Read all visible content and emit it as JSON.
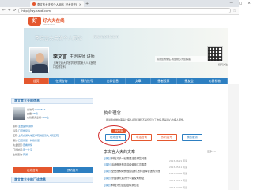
{
  "browser": {
    "tab_title": "李文言大夫的个人网站_好大夫在线",
    "tab_close": "×",
    "new_tab": "+",
    "window_controls": [
      "—",
      "□",
      "×"
    ],
    "nav_buttons": [
      "←",
      "→",
      "⟳"
    ],
    "url": "http://lwy.haodf.com/",
    "star": "☆"
  },
  "site": {
    "logo_text": "好",
    "brand": "好大夫在线",
    "brand_sub": "haodf.com",
    "banner_title": "李文言大夫的个人网站",
    "banner_domain": "lwy.haodf.com",
    "banner_tagline": "感谢您的信任,我会耐心为您解答"
  },
  "doctor": {
    "name": "李文言",
    "title": "主治医师 讲师",
    "hospital": "上海交通大学医学院附属第九人民医院",
    "department": "口腔修复科",
    "qr_label": "扫码关注"
  },
  "nav": {
    "items": [
      "首页",
      "在线咨询",
      "预约挂号",
      "出诊信息",
      "文章",
      "患者投票",
      "患友会",
      "心意礼物"
    ]
  },
  "left": {
    "header": "李文言大夫的信息",
    "rows": [
      {
        "label": "总访问:",
        "value": "1234567"
      },
      {
        "label": "文章:",
        "value": "28篇"
      },
      {
        "label": "在线服务患者:",
        "value": "368位"
      }
    ],
    "info": [
      {
        "label": "职称:",
        "value": "主治医师 讲师"
      },
      {
        "label": "科室:",
        "value": "口腔修复科"
      },
      {
        "label": "医院:",
        "value": "上海交通大学医学院附属第九人民医院"
      },
      {
        "label": "擅长:",
        "value": "口腔修复、种植修复"
      },
      {
        "label": "执业经历:",
        "value": "查看详情"
      },
      {
        "label": "门诊时间:",
        "value": "周一上午"
      },
      {
        "label": "在线咨询:",
        "value": "开通"
      }
    ],
    "button_consult": "在线咨询",
    "button_appoint": "预约挂号",
    "footer_header": "李文言大夫的门诊信息"
  },
  "right": {
    "philosophy_title": "执业理念",
    "philosophy_text": "我说我在做的事情让病人感到温暖,不是仅仅为了治病,而是用心为病人服务。",
    "services": [
      "在线咨询",
      "电话咨询",
      "预约挂号",
      "我的服务"
    ],
    "service_badge": "图文咨询",
    "articles_title": "李文言大夫的文章",
    "articles_more": "更多>>",
    "articles": [
      {
        "tag": "[原创]",
        "title": "种植牙手术后需要注意哪些问题",
        "meta": "2013-06-21 阅读"
      },
      {
        "tag": "[原创]",
        "title": "活动假牙的清洁和使用注意事项",
        "meta": "2013-05-11 阅读"
      },
      {
        "tag": "[原创]",
        "title": "全瓷冠和烤瓷冠的区别,怎样选择合适的牙冠",
        "meta": "2013-04-08 阅读"
      },
      {
        "tag": "[原创]",
        "title": "牙齿缺失后为什么要及时修复",
        "meta": "2013-03-17 阅读"
      },
      {
        "tag": "[原创]",
        "title": "种植牙的适应症和禁忌症",
        "meta": "2013-02-20 阅读"
      }
    ]
  }
}
